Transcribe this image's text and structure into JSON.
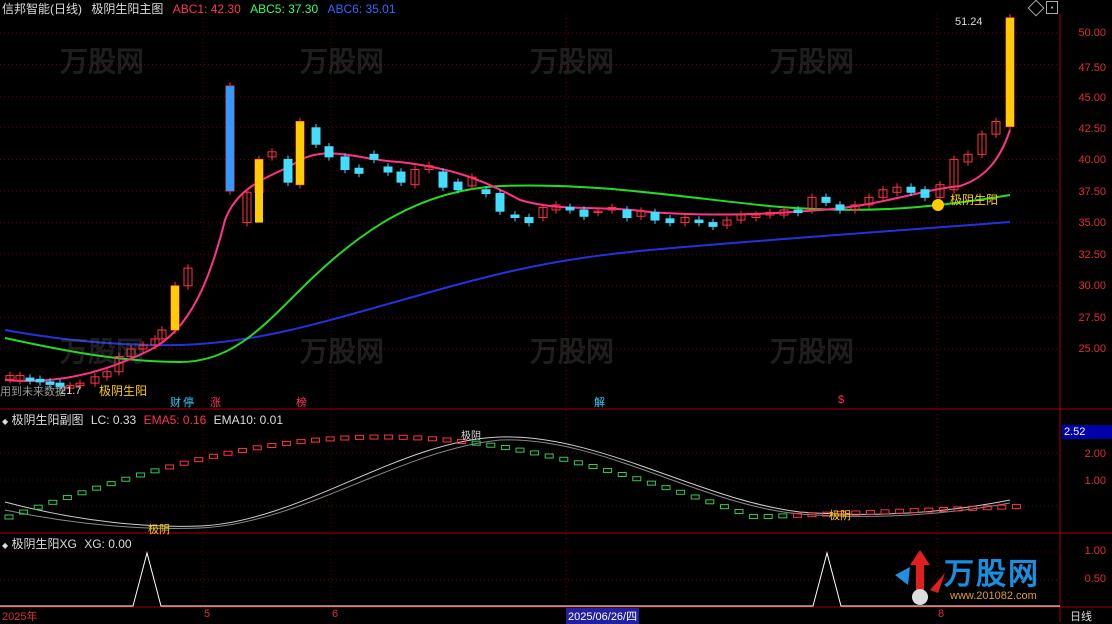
{
  "header": {
    "title": "信邦智能(日线)",
    "indicator_name": "极阴生阳主图",
    "abc1": "ABC1: 42.30",
    "abc5": "ABC5: 37.30",
    "abc6": "ABC6: 35.01",
    "colors": {
      "abc1": "#ff3355",
      "abc5": "#33ff66",
      "abc6": "#3366ff"
    }
  },
  "sub1": {
    "title": "极阴生阳副图",
    "lc": "LC: 0.33",
    "ema5": "EMA5: 0.16",
    "ema10": "EMA10: 0.01",
    "current_value": "2.52",
    "y_labels": [
      "2.00",
      "1.00"
    ],
    "signals": [
      "极阴",
      "极阴"
    ],
    "peak_label": "极阴"
  },
  "sub2": {
    "title": "极阴生阳XG",
    "xg": "XG: 0.00",
    "y_labels": [
      "1.00",
      "0.50"
    ]
  },
  "main": {
    "y_labels": [
      "50.00",
      "47.50",
      "45.00",
      "42.50",
      "40.00",
      "37.50",
      "35.00",
      "32.50",
      "30.00",
      "27.50",
      "25.00"
    ],
    "high_label": "51.24",
    "low_label": "21.7",
    "signals": [
      "极阴生阳",
      "极阴生阳"
    ],
    "bottom_note": "用到未来数据",
    "events": [
      {
        "text": "财",
        "color": "#33ccff"
      },
      {
        "text": "停",
        "color": "#33ccff"
      },
      {
        "text": "涨",
        "color": "#ff3355"
      },
      {
        "text": "榜",
        "color": "#ff3355"
      },
      {
        "text": "解",
        "color": "#33ccff"
      },
      {
        "text": "$",
        "color": "#ff3355"
      }
    ]
  },
  "x_axis": {
    "labels": [
      "2025年",
      "5",
      "6",
      "2025/06/26/四",
      "8"
    ],
    "period": "日线"
  },
  "watermark": {
    "text": "万股网",
    "site": "www.201082.com"
  }
}
